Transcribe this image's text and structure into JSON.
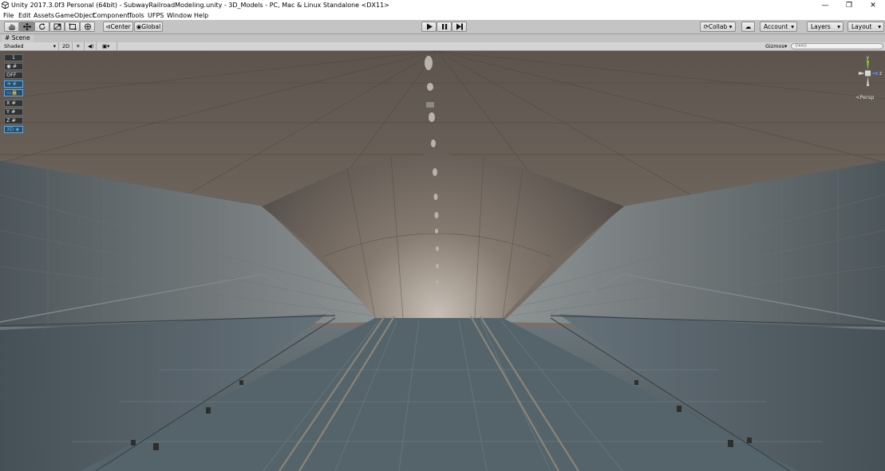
{
  "window": {
    "title": "Unity 2017.3.0f3 Personal (64bit) - SubwayRailroadModeling.unity - 3D_Models - PC, Mac & Linux Standalone <DX11>",
    "minimize": "—",
    "restore": "❐",
    "close": "✕"
  },
  "menu": [
    "File",
    "Edit",
    "Assets",
    "GameObject",
    "Component",
    "Tools",
    "UFPS",
    "Window",
    "Help"
  ],
  "toolbar": {
    "tools": [
      "hand-icon",
      "move-icon",
      "rotate-icon",
      "scale-icon",
      "rect-icon",
      "transform-icon"
    ],
    "pivot_mode": "Center",
    "pivot_rotation": "Global",
    "play_icon": "play-icon",
    "pause_icon": "pause-icon",
    "step_icon": "step-icon",
    "collab": "Collab ▾",
    "account": "Account",
    "layers": "Layers",
    "layout": "Layout"
  },
  "scene": {
    "tab_label": "Scene",
    "shading_mode": "Shaded",
    "mode_2d": "2D",
    "gizmos": "Gizmos",
    "search_placeholder": "All",
    "persp_label": "Persp",
    "overlay": {
      "b1": "1",
      "b3": "OFF",
      "b8": "X",
      "b9": "Y",
      "b10": "Z",
      "b11": "3D"
    },
    "gizmo_axes": {
      "y": "y",
      "z": "z"
    }
  },
  "colors": {
    "viewport_bg": "#505253",
    "ceiling": "#6b5f55",
    "floor": "#4e5a60",
    "accent_blue": "#5cc4ff"
  }
}
